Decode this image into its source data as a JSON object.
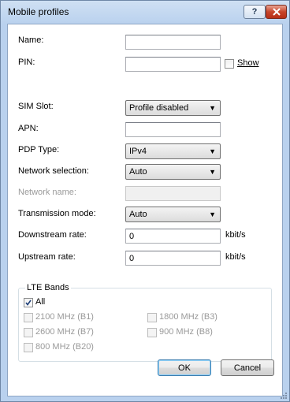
{
  "window": {
    "title": "Mobile profiles",
    "help_label": "?"
  },
  "fields": {
    "name_label": "Name:",
    "name_value": "",
    "pin_label": "PIN:",
    "pin_value": "",
    "show_label": "Show",
    "show_checked": false,
    "sim_slot_label": "SIM Slot:",
    "sim_slot_value": "Profile disabled",
    "apn_label": "APN:",
    "apn_value": "",
    "pdp_type_label": "PDP Type:",
    "pdp_type_value": "IPv4",
    "network_selection_label": "Network selection:",
    "network_selection_value": "Auto",
    "network_name_label": "Network name:",
    "network_name_value": "",
    "transmission_mode_label": "Transmission mode:",
    "transmission_mode_value": "Auto",
    "downstream_label": "Downstream rate:",
    "downstream_value": "0",
    "downstream_unit": "kbit/s",
    "upstream_label": "Upstream rate:",
    "upstream_value": "0",
    "upstream_unit": "kbit/s"
  },
  "lte_bands": {
    "title": "LTE Bands",
    "all": {
      "label": "All",
      "checked": true
    },
    "bands": [
      {
        "label": "2100 MHz (B1)",
        "checked": false,
        "enabled": false
      },
      {
        "label": "1800 MHz (B3)",
        "checked": false,
        "enabled": false
      },
      {
        "label": "2600 MHz (B7)",
        "checked": false,
        "enabled": false
      },
      {
        "label": "900 MHz (B8)",
        "checked": false,
        "enabled": false
      },
      {
        "label": "800 MHz (B20)",
        "checked": false,
        "enabled": false
      }
    ]
  },
  "buttons": {
    "ok": "OK",
    "cancel": "Cancel"
  },
  "colors": {
    "title_bar": "#b9d1ee",
    "close_button": "#c7452a",
    "disabled_text": "#9a9a9a"
  }
}
